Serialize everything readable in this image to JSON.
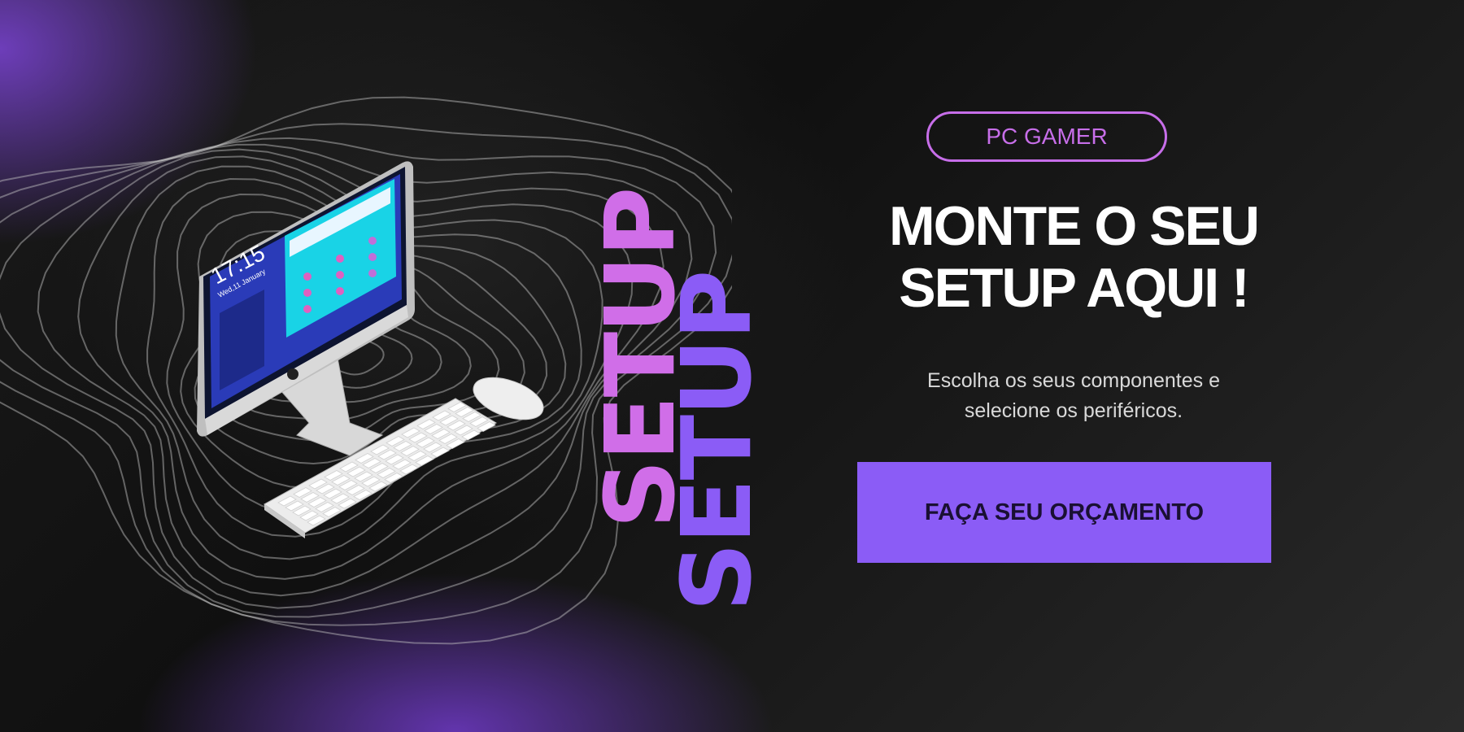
{
  "badge": {
    "label": "PC GAMER"
  },
  "headline": {
    "line1": "MONTE O SEU",
    "line2": "SETUP AQUI !"
  },
  "subtitle": {
    "line1": "Escolha os seus componentes e",
    "line2": "selecione os periféricos."
  },
  "cta": {
    "label": "FAÇA SEU ORÇAMENTO"
  },
  "decor": {
    "setup_word": "SETUP"
  },
  "screen": {
    "time": "17:15",
    "date": "Wed,11 January"
  },
  "colors": {
    "accent_purple": "#8b5cf6",
    "accent_pink": "#d06ee8",
    "background": "#141414",
    "text": "#ffffff"
  }
}
